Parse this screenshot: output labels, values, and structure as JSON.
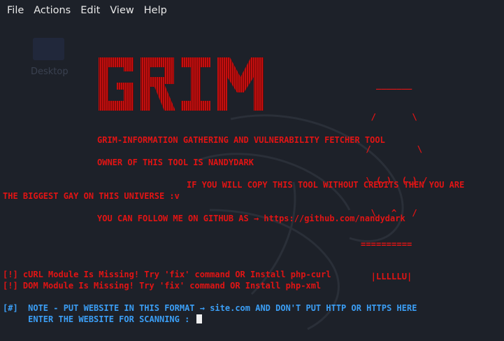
{
  "menu": [
    "File",
    "Actions",
    "Edit",
    "View",
    "Help"
  ],
  "desktop": {
    "icon_label": "Desktop"
  },
  "banner": {
    "logo_text": "GRIM",
    "skull_lines": [
      "   _______",
      "  /       \\",
      " /         \\",
      " \\ (.)  (.) /",
      "  \\   ^   /",
      "==========",
      "  |LLLLLU|"
    ],
    "tagline": "GRIM-INFORMATION GATHERING AND VULNERABILITY FETCHER TOOL",
    "owner": "OWNER OF THIS TOOL IS NANDYDARK",
    "warning_1": "IF YOU WILL COPY THIS TOOL WITHOUT CREDITS THEN YOU ARE",
    "warning_2": "THE BIGGEST GAY ON THIS UNIVERSE :v",
    "follow": "YOU CAN FOLLOW ME ON GITHUB AS → https://github.com/nandydark"
  },
  "errors": [
    "[!] cURL Module Is Missing! Try 'fix' command OR Install php-curl",
    "[!] DOM Module Is Missing! Try 'fix' command OR Install php-xml"
  ],
  "prompt": {
    "note": "[#]  NOTE - PUT WEBSITE IN THIS FORMAT → site.com AND DON'T PUT HTTP OR HTTPS HERE",
    "input_label": "     ENTER THE WEBSITE FOR SCANNING : "
  },
  "colors": {
    "error_red": "#e11414",
    "info_blue": "#3b9ef5",
    "background": "#1d2129"
  }
}
